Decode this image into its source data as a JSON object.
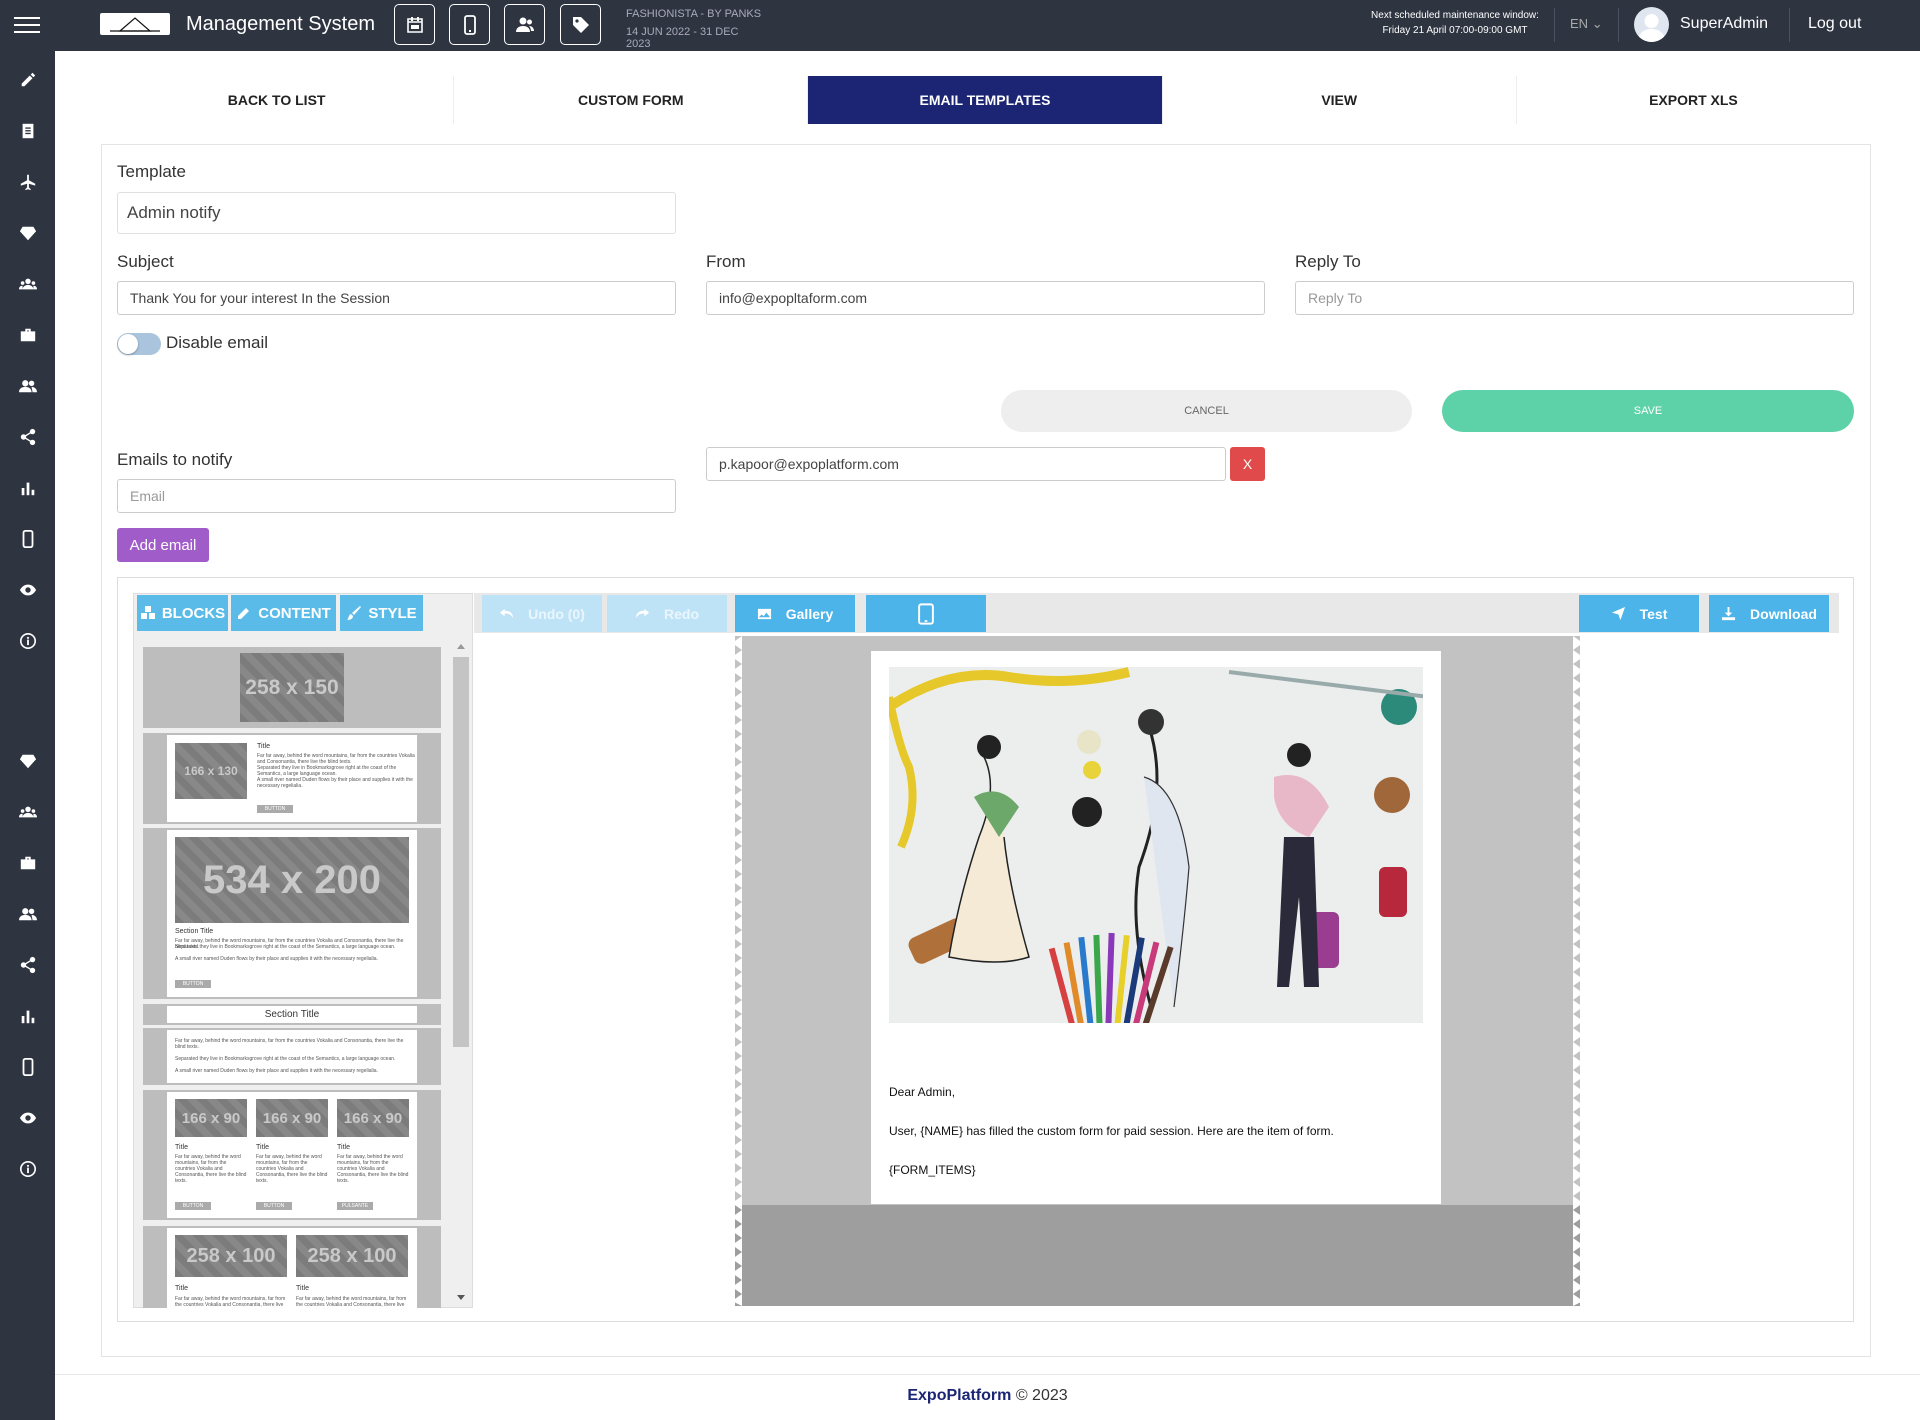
{
  "topbar": {
    "app_title": "Management System",
    "event_name": "FASHIONISTA - BY PANKS",
    "event_dates": "14 JUN 2022 - 31 DEC 2023",
    "maintenance_line1": "Next scheduled maintenance window:",
    "maintenance_line2": "Friday 21 April 07:00-09:00 GMT",
    "language": "EN",
    "username": "SuperAdmin",
    "logout": "Log out",
    "icons": [
      "calendar-icon",
      "mobile-icon",
      "users-icon",
      "tag-icon"
    ]
  },
  "sidebar": {
    "icons": [
      "pencil-icon",
      "document-icon",
      "plane-icon",
      "diamond-icon",
      "group-icon",
      "briefcase-icon",
      "users-icon",
      "share-icon",
      "bar-chart-icon",
      "mobile-icon",
      "eye-icon",
      "info-icon",
      "diamond-icon",
      "group-icon",
      "briefcase-icon",
      "users-icon",
      "share-icon",
      "bar-chart-icon",
      "mobile-icon",
      "eye-icon",
      "info-icon"
    ]
  },
  "tabs": [
    {
      "label": "BACK TO LIST",
      "active": false
    },
    {
      "label": "CUSTOM FORM",
      "active": false
    },
    {
      "label": "EMAIL TEMPLATES",
      "active": true
    },
    {
      "label": "VIEW",
      "active": false
    },
    {
      "label": "EXPORT XLS",
      "active": false
    }
  ],
  "form": {
    "template_label": "Template",
    "template_value": "Admin notify",
    "subject_label": "Subject",
    "subject_value": "Thank You for your interest In the Session",
    "from_label": "From",
    "from_value": "info@expopltaform.com",
    "reply_to_label": "Reply To",
    "reply_to_placeholder": "Reply To",
    "disable_email_label": "Disable email",
    "disable_email_on": false,
    "cancel_label": "CANCEL",
    "save_label": "SAVE",
    "emails_label": "Emails to notify",
    "email_placeholder": "Email",
    "notify_email": "p.kapoor@expoplatform.com",
    "remove_label": "X",
    "add_email_label": "Add email"
  },
  "editor": {
    "tabs": {
      "blocks": "BLOCKS",
      "content": "CONTENT",
      "style": "STYLE"
    },
    "toolbar": {
      "undo": "Undo (0)",
      "redo": "Redo",
      "gallery": "Gallery",
      "test": "Test",
      "download": "Download"
    },
    "blocks": {
      "b1": "258 x 150",
      "b2": "166 x 130",
      "b3": "534 x 200",
      "b5_section": "Section Title",
      "b7a": "166 x 90",
      "b7b": "166 x 90",
      "b7c": "166 x 90",
      "b8a": "258 x 100",
      "b8b": "258 x 100",
      "title": "Title",
      "section_title": "Section Title",
      "lorem1": "Far far away, behind the word mountains, far from the countries Vokalia and Consonantia, there live the blind texts.",
      "lorem2": "Separated they live in Bookmarksgrove right at the coast of the Semantics, a large language ocean.",
      "lorem3": "A small river named Duden flows by their place and supplies it with the necessary regelialia.",
      "button": "BUTTON",
      "button_alt": "PULSANTE"
    },
    "email": {
      "greeting": "Dear Admin,",
      "body": "User, {NAME} has filled the custom form for paid session. Here are the item of form.",
      "items": "{FORM_ITEMS}"
    }
  },
  "footer": {
    "brand": "ExpoPlatform",
    "year": "© 2023"
  },
  "colors": {
    "topbar": "#2e3440",
    "active_tab": "#1b2574",
    "save": "#5dd2a8",
    "add_email": "#a05cc9",
    "remove": "#e04a4a",
    "editor_accent": "#4db4ea"
  }
}
